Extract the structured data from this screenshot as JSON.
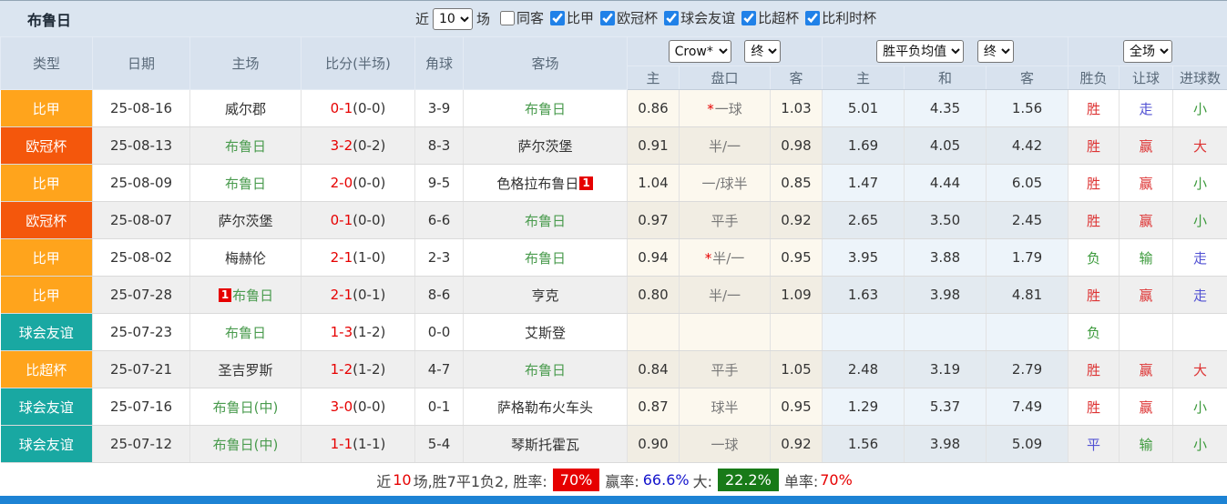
{
  "header": {
    "team": "布鲁日",
    "recent_label": "近",
    "matches_count": "10",
    "matches_label": "场",
    "filters": [
      {
        "label": "同客",
        "checked": false
      },
      {
        "label": "比甲",
        "checked": true
      },
      {
        "label": "欧冠杯",
        "checked": true
      },
      {
        "label": "球会友谊",
        "checked": true
      },
      {
        "label": "比超杯",
        "checked": true
      },
      {
        "label": "比利时杯",
        "checked": true
      }
    ]
  },
  "table": {
    "columns": [
      "类型",
      "日期",
      "主场",
      "比分(半场)",
      "角球",
      "客场"
    ],
    "group_selects": {
      "crown_company": "Crow*",
      "crown_final": "终",
      "avg_label": "胜平负均值",
      "avg_final": "终",
      "result_scope": "全场"
    },
    "sub_columns": [
      "主",
      "盘口",
      "客",
      "主",
      "和",
      "客",
      "胜负",
      "让球",
      "进球数"
    ],
    "league_colors": {
      "比甲": "#ffa41c",
      "欧冠杯": "#f4570c",
      "球会友谊": "#19a8a2",
      "比超杯": "#ffa41c"
    },
    "rows": [
      {
        "league": "比甲",
        "league_color": "#ffa41c",
        "date": "25-08-16",
        "home": {
          "name": "威尔郡",
          "subject": false,
          "red": "",
          "red_pos": ""
        },
        "score": "0-1",
        "half": "(0-0)",
        "corners": "3-9",
        "away": {
          "name": "布鲁日",
          "subject": true,
          "red": "",
          "red_pos": ""
        },
        "crown": {
          "home": "0.86",
          "star": true,
          "handicap": "一球",
          "away": "1.03"
        },
        "avg": {
          "home": "5.01",
          "draw": "4.35",
          "away": "1.56"
        },
        "result": [
          {
            "t": "胜",
            "c": "r"
          },
          {
            "t": "走",
            "c": "b"
          },
          {
            "t": "小",
            "c": "g"
          }
        ]
      },
      {
        "league": "欧冠杯",
        "league_color": "#f4570c",
        "date": "25-08-13",
        "home": {
          "name": "布鲁日",
          "subject": true,
          "red": "",
          "red_pos": ""
        },
        "score": "3-2",
        "half": "(0-2)",
        "corners": "8-3",
        "away": {
          "name": "萨尔茨堡",
          "subject": false,
          "red": "",
          "red_pos": ""
        },
        "crown": {
          "home": "0.91",
          "star": false,
          "handicap": "半/一",
          "away": "0.98"
        },
        "avg": {
          "home": "1.69",
          "draw": "4.05",
          "away": "4.42"
        },
        "result": [
          {
            "t": "胜",
            "c": "r"
          },
          {
            "t": "赢",
            "c": "r"
          },
          {
            "t": "大",
            "c": "r"
          }
        ]
      },
      {
        "league": "比甲",
        "league_color": "#ffa41c",
        "date": "25-08-09",
        "home": {
          "name": "布鲁日",
          "subject": true,
          "red": "",
          "red_pos": ""
        },
        "score": "2-0",
        "half": "(0-0)",
        "corners": "9-5",
        "away": {
          "name": "色格拉布鲁日",
          "subject": false,
          "red": "1",
          "red_pos": "after"
        },
        "crown": {
          "home": "1.04",
          "star": false,
          "handicap": "一/球半",
          "away": "0.85"
        },
        "avg": {
          "home": "1.47",
          "draw": "4.44",
          "away": "6.05"
        },
        "result": [
          {
            "t": "胜",
            "c": "r"
          },
          {
            "t": "赢",
            "c": "r"
          },
          {
            "t": "小",
            "c": "g"
          }
        ]
      },
      {
        "league": "欧冠杯",
        "league_color": "#f4570c",
        "date": "25-08-07",
        "home": {
          "name": "萨尔茨堡",
          "subject": false,
          "red": "",
          "red_pos": ""
        },
        "score": "0-1",
        "half": "(0-0)",
        "corners": "6-6",
        "away": {
          "name": "布鲁日",
          "subject": true,
          "red": "",
          "red_pos": ""
        },
        "crown": {
          "home": "0.97",
          "star": false,
          "handicap": "平手",
          "away": "0.92"
        },
        "avg": {
          "home": "2.65",
          "draw": "3.50",
          "away": "2.45"
        },
        "result": [
          {
            "t": "胜",
            "c": "r"
          },
          {
            "t": "赢",
            "c": "r"
          },
          {
            "t": "小",
            "c": "g"
          }
        ]
      },
      {
        "league": "比甲",
        "league_color": "#ffa41c",
        "date": "25-08-02",
        "home": {
          "name": "梅赫伦",
          "subject": false,
          "red": "",
          "red_pos": ""
        },
        "score": "2-1",
        "half": "(1-0)",
        "corners": "2-3",
        "away": {
          "name": "布鲁日",
          "subject": true,
          "red": "",
          "red_pos": ""
        },
        "crown": {
          "home": "0.94",
          "star": true,
          "handicap": "半/一",
          "away": "0.95"
        },
        "avg": {
          "home": "3.95",
          "draw": "3.88",
          "away": "1.79"
        },
        "result": [
          {
            "t": "负",
            "c": "g"
          },
          {
            "t": "输",
            "c": "g"
          },
          {
            "t": "走",
            "c": "b"
          }
        ]
      },
      {
        "league": "比甲",
        "league_color": "#ffa41c",
        "date": "25-07-28",
        "home": {
          "name": "布鲁日",
          "subject": true,
          "red": "1",
          "red_pos": "before"
        },
        "score": "2-1",
        "half": "(0-1)",
        "corners": "8-6",
        "away": {
          "name": "亨克",
          "subject": false,
          "red": "",
          "red_pos": ""
        },
        "crown": {
          "home": "0.80",
          "star": false,
          "handicap": "半/一",
          "away": "1.09"
        },
        "avg": {
          "home": "1.63",
          "draw": "3.98",
          "away": "4.81"
        },
        "result": [
          {
            "t": "胜",
            "c": "r"
          },
          {
            "t": "赢",
            "c": "r"
          },
          {
            "t": "走",
            "c": "b"
          }
        ]
      },
      {
        "league": "球会友谊",
        "league_color": "#19a8a2",
        "date": "25-07-23",
        "home": {
          "name": "布鲁日",
          "subject": true,
          "red": "",
          "red_pos": ""
        },
        "score": "1-3",
        "half": "(1-2)",
        "corners": "0-0",
        "away": {
          "name": "艾斯登",
          "subject": false,
          "red": "",
          "red_pos": ""
        },
        "crown": {
          "home": "",
          "star": false,
          "handicap": "",
          "away": ""
        },
        "avg": {
          "home": "",
          "draw": "",
          "away": ""
        },
        "result": [
          {
            "t": "负",
            "c": "g"
          },
          {
            "t": "",
            "c": ""
          },
          {
            "t": "",
            "c": ""
          }
        ]
      },
      {
        "league": "比超杯",
        "league_color": "#ffa41c",
        "date": "25-07-21",
        "home": {
          "name": "圣吉罗斯",
          "subject": false,
          "red": "",
          "red_pos": ""
        },
        "score": "1-2",
        "half": "(1-2)",
        "corners": "4-7",
        "away": {
          "name": "布鲁日",
          "subject": true,
          "red": "",
          "red_pos": ""
        },
        "crown": {
          "home": "0.84",
          "star": false,
          "handicap": "平手",
          "away": "1.05"
        },
        "avg": {
          "home": "2.48",
          "draw": "3.19",
          "away": "2.79"
        },
        "result": [
          {
            "t": "胜",
            "c": "r"
          },
          {
            "t": "赢",
            "c": "r"
          },
          {
            "t": "大",
            "c": "r"
          }
        ]
      },
      {
        "league": "球会友谊",
        "league_color": "#19a8a2",
        "date": "25-07-16",
        "home": {
          "name": "布鲁日(中)",
          "subject": true,
          "red": "",
          "red_pos": ""
        },
        "score": "3-0",
        "half": "(0-0)",
        "corners": "0-1",
        "away": {
          "name": "萨格勒布火车头",
          "subject": false,
          "red": "",
          "red_pos": ""
        },
        "crown": {
          "home": "0.87",
          "star": false,
          "handicap": "球半",
          "away": "0.95"
        },
        "avg": {
          "home": "1.29",
          "draw": "5.37",
          "away": "7.49"
        },
        "result": [
          {
            "t": "胜",
            "c": "r"
          },
          {
            "t": "赢",
            "c": "r"
          },
          {
            "t": "小",
            "c": "g"
          }
        ]
      },
      {
        "league": "球会友谊",
        "league_color": "#19a8a2",
        "date": "25-07-12",
        "home": {
          "name": "布鲁日(中)",
          "subject": true,
          "red": "",
          "red_pos": ""
        },
        "score": "1-1",
        "half": "(1-1)",
        "corners": "5-4",
        "away": {
          "name": "琴斯托霍瓦",
          "subject": false,
          "red": "",
          "red_pos": ""
        },
        "crown": {
          "home": "0.90",
          "star": false,
          "handicap": "一球",
          "away": "0.92"
        },
        "avg": {
          "home": "1.56",
          "draw": "3.98",
          "away": "5.09"
        },
        "result": [
          {
            "t": "平",
            "c": "b"
          },
          {
            "t": "输",
            "c": "g"
          },
          {
            "t": "小",
            "c": "g"
          }
        ]
      }
    ]
  },
  "summary": {
    "segments": [
      {
        "text": "近",
        "cls": "plain"
      },
      {
        "text": "10",
        "cls": "red-text"
      },
      {
        "text": "场,胜7平1负2, 胜率:",
        "cls": "plain"
      },
      {
        "text": "70%",
        "cls": "red-badge"
      },
      {
        "text": "赢率:",
        "cls": "plain"
      },
      {
        "text": "66.6%",
        "cls": "blue-text"
      },
      {
        "text": "大:",
        "cls": "plain"
      },
      {
        "text": "22.2%",
        "cls": "green-badge"
      },
      {
        "text": "单率:",
        "cls": "plain"
      },
      {
        "text": "70%",
        "cls": "red-text"
      }
    ]
  },
  "colors": {
    "accent_blue": "#2081e8",
    "league_orange": "#ffa41c",
    "league_red_orange": "#f4570c",
    "league_teal": "#19a8a2",
    "win_red": "#dd3333",
    "lose_green": "#3c9a3c",
    "push_blue": "#5151d3",
    "score_red": "#e60000",
    "subject_green": "#4a9b4e",
    "bottom_strip": "#1d83d4"
  }
}
